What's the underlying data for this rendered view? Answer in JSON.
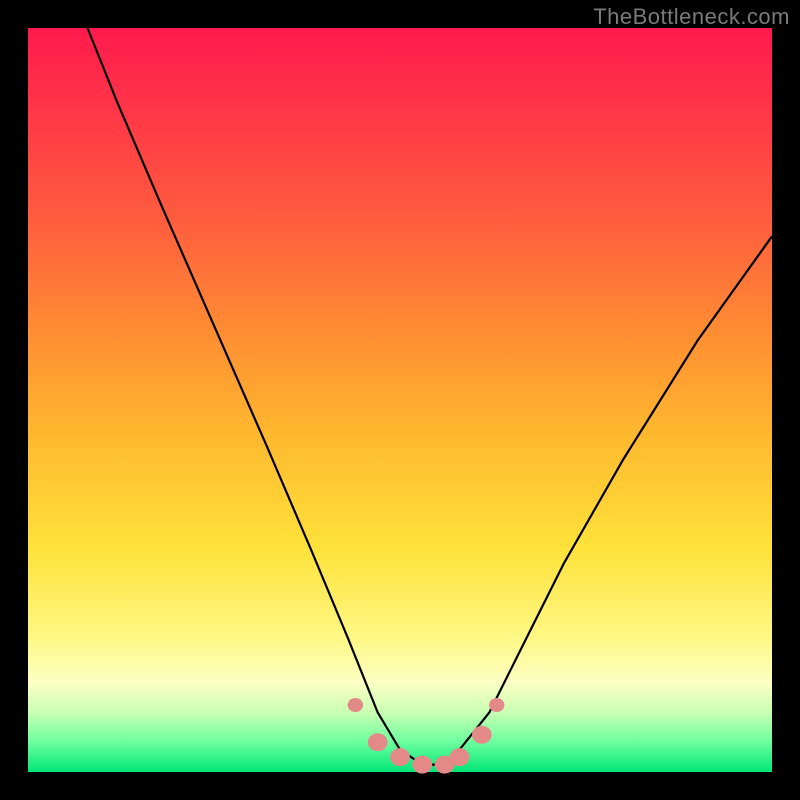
{
  "watermark": "TheBottleneck.com",
  "chart_data": {
    "type": "line",
    "title": "",
    "xlabel": "",
    "ylabel": "",
    "xlim": [
      0,
      100
    ],
    "ylim": [
      0,
      100
    ],
    "series": [
      {
        "name": "bottleneck-curve",
        "x": [
          8,
          12,
          18,
          25,
          32,
          38,
          43,
          47,
          50,
          53,
          56,
          58,
          62,
          66,
          72,
          80,
          90,
          100
        ],
        "y": [
          100,
          90,
          76,
          60,
          44,
          30,
          18,
          8,
          3,
          1,
          1,
          3,
          8,
          16,
          28,
          42,
          58,
          72
        ]
      }
    ],
    "markers": {
      "name": "highlight-points",
      "color": "#e38a88",
      "x": [
        44,
        47,
        50,
        53,
        56,
        58,
        61,
        63
      ],
      "y": [
        9,
        4,
        2,
        1,
        1,
        2,
        5,
        9
      ]
    },
    "gradient_stops": [
      {
        "pos": 0,
        "color": "#ff1a4d"
      },
      {
        "pos": 25,
        "color": "#ff5a3f"
      },
      {
        "pos": 55,
        "color": "#ffb92e"
      },
      {
        "pos": 82,
        "color": "#fff885"
      },
      {
        "pos": 100,
        "color": "#00e676"
      }
    ]
  }
}
